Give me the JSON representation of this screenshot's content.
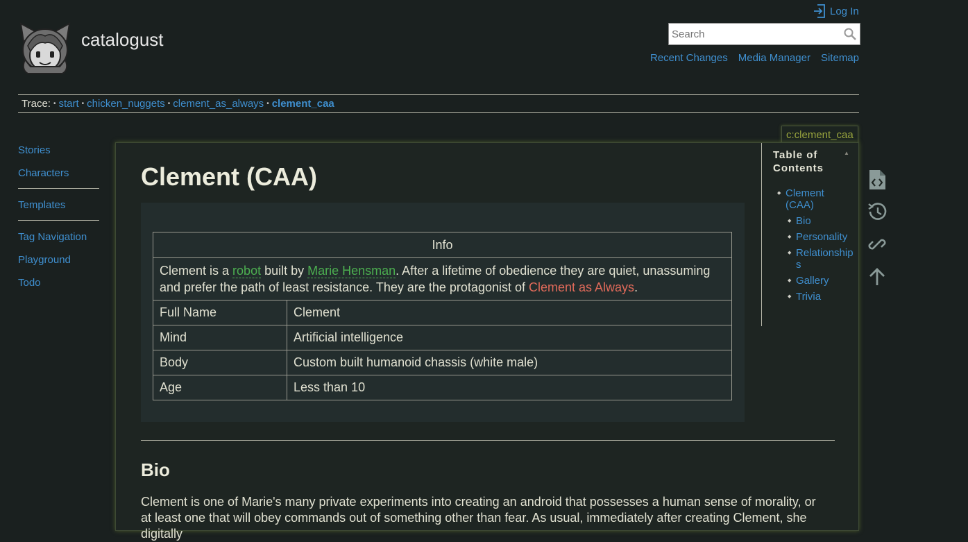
{
  "site": {
    "title": "catalogust"
  },
  "user": {
    "login_label": "Log In"
  },
  "search": {
    "placeholder": "Search"
  },
  "topnav": [
    "Recent Changes",
    "Media Manager",
    "Sitemap"
  ],
  "trace": {
    "label": "Trace:",
    "items": [
      "start",
      "chicken_nuggets",
      "clement_as_always",
      "clement_caa"
    ]
  },
  "sidebar": {
    "items": [
      "Stories",
      "Characters",
      "Templates",
      "Tag Navigation",
      "Playground",
      "Todo"
    ]
  },
  "page": {
    "id": "c:clement_caa",
    "title": "Clement (CAA)",
    "infobox": {
      "header": "Info",
      "desc_1": "Clement is a ",
      "desc_link_1": "robot",
      "desc_2": " built by ",
      "desc_link_2": "Marie Hensman",
      "desc_3": ". After a lifetime of obedience they are quiet, unassuming and prefer the path of least resistance. They are the protagonist of ",
      "desc_link_3": "Clement as Always",
      "desc_4": ".",
      "rows": [
        {
          "key": "Full Name",
          "value": "Clement"
        },
        {
          "key": "Mind",
          "value": "Artificial intelligence"
        },
        {
          "key": "Body",
          "value": "Custom built humanoid chassis (white male)"
        },
        {
          "key": "Age",
          "value": "Less than 10"
        }
      ]
    },
    "bio_heading": "Bio",
    "bio_text": "Clement is one of Marie's many private experiments into creating an android that possesses a human sense of morality, or at least one that will obey commands out of something other than fear. As usual, immediately after creating Clement, she digitally"
  },
  "toc": {
    "title": "Table of Contents",
    "toggle": "▲",
    "items": [
      "Clement (CAA)",
      "Bio",
      "Personality",
      "Relationships",
      "Gallery",
      "Trivia"
    ]
  },
  "tools": [
    "view-source-icon",
    "old-revisions-icon",
    "backlinks-icon",
    "back-to-top-icon"
  ],
  "colors": {
    "background": "#1a201f",
    "link": "#3f8fcf",
    "internal_link": "#4caf50",
    "missing_link": "#e06a5a",
    "accent": "#9aa63e"
  }
}
